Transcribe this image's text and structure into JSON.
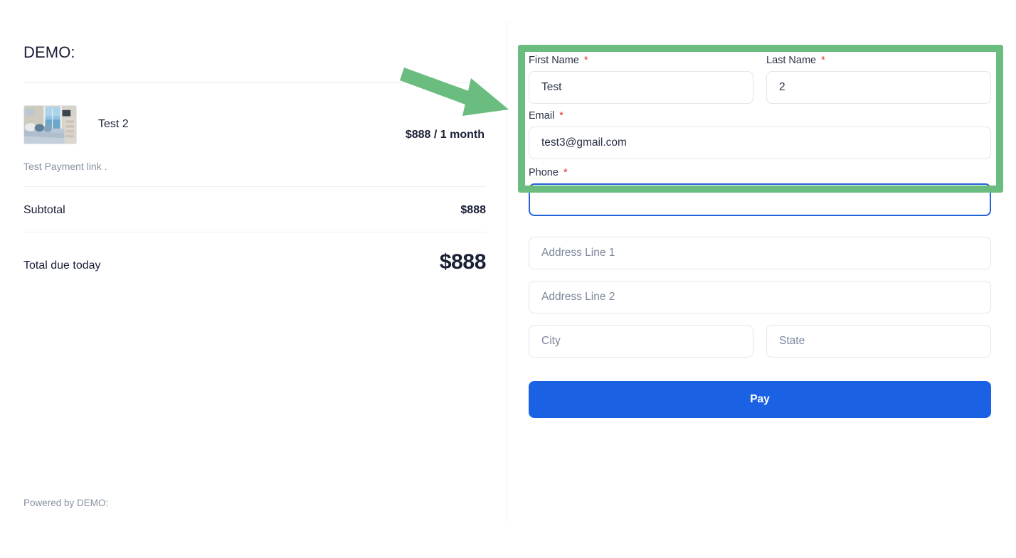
{
  "brand": {
    "title": "DEMO:",
    "powered_by": "Powered by DEMO:"
  },
  "order_summary": {
    "line_item": {
      "name": "Test 2",
      "price": "$888 / 1 month",
      "description": "Test Payment link .",
      "thumbnail_icon": "bedroom-photo-thumbnail"
    },
    "subtotal": {
      "label": "Subtotal",
      "value": "$888"
    },
    "total": {
      "label": "Total due today",
      "value": "$888"
    }
  },
  "checkout_form": {
    "first_name": {
      "label": "First Name",
      "required_marker": "*",
      "value": "Test",
      "placeholder": ""
    },
    "last_name": {
      "label": "Last Name",
      "required_marker": "*",
      "value": "2",
      "placeholder": ""
    },
    "email": {
      "label": "Email",
      "required_marker": "*",
      "value": "test3@gmail.com",
      "placeholder": ""
    },
    "phone": {
      "label": "Phone",
      "required_marker": "*",
      "value": "",
      "placeholder": ""
    },
    "address_line_1": {
      "value": "",
      "placeholder": "Address Line 1"
    },
    "address_line_2": {
      "value": "",
      "placeholder": "Address Line 2"
    },
    "city": {
      "value": "",
      "placeholder": "City"
    },
    "state": {
      "value": "",
      "placeholder": "State"
    },
    "pay_button_label": "Pay"
  },
  "annotation": {
    "highlight_color": "#6bbd7f",
    "arrow_color": "#6bbd7f",
    "arrow_direction": "right",
    "target": "name-and-email-fields"
  },
  "colors": {
    "pay_button_bg": "#1b61e4",
    "focus_border": "#2563d9",
    "required_asterisk": "#e03131",
    "text_primary": "#1a1f36",
    "text_muted": "#8792a2"
  }
}
